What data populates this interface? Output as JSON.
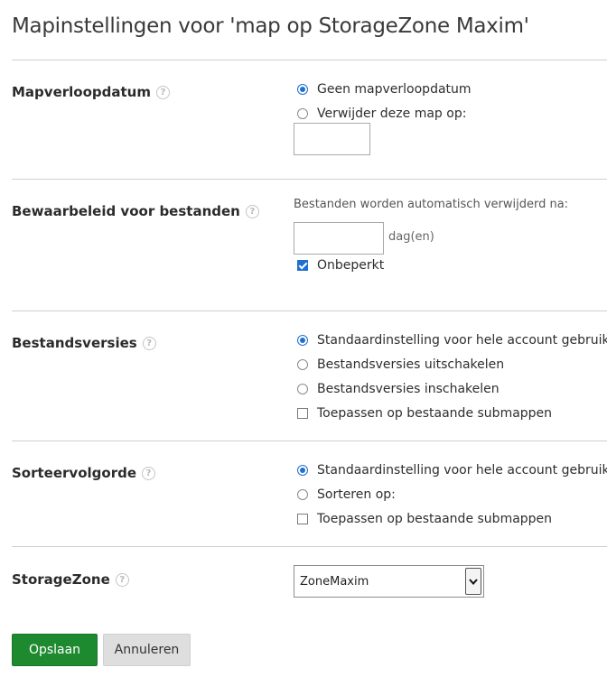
{
  "page": {
    "title": "Mapinstellingen voor 'map op StorageZone Maxim'"
  },
  "help_icon_glyph": "?",
  "sections": {
    "expiration": {
      "label": "Mapverloopdatum",
      "options": [
        {
          "label": "Geen mapverloopdatum",
          "selected": true
        },
        {
          "label": "Verwijder deze map op:",
          "selected": false
        }
      ],
      "date_value": ""
    },
    "retention": {
      "label": "Bewaarbeleid voor bestanden",
      "note": "Bestanden worden automatisch verwijderd na:",
      "days_value": "",
      "unit": "dag(en)",
      "unlimited": {
        "label": "Onbeperkt",
        "checked": true
      }
    },
    "versions": {
      "label": "Bestandsversies",
      "options": [
        {
          "label": "Standaardinstelling voor hele account gebruiken",
          "selected": true
        },
        {
          "label": "Bestandsversies uitschakelen",
          "selected": false
        },
        {
          "label": "Bestandsversies inschakelen",
          "selected": false
        }
      ],
      "apply_sub": {
        "label": "Toepassen op bestaande submappen",
        "checked": false
      }
    },
    "sort": {
      "label": "Sorteervolgorde",
      "options": [
        {
          "label": "Standaardinstelling voor hele account gebruiken",
          "selected": true
        },
        {
          "label": "Sorteren op:",
          "selected": false
        }
      ],
      "apply_sub": {
        "label": "Toepassen op bestaande submappen",
        "checked": false
      }
    },
    "storagezone": {
      "label": "StorageZone",
      "selected_value": "ZoneMaxim"
    }
  },
  "buttons": {
    "save": "Opslaan",
    "cancel": "Annuleren"
  },
  "colors": {
    "accent": "#1f6fcf",
    "primary_button": "#1e8a2f",
    "secondary_button": "#dedede"
  },
  "icons": {
    "help": "help-circle-icon",
    "select_arrow": "chevron-down-icon"
  }
}
